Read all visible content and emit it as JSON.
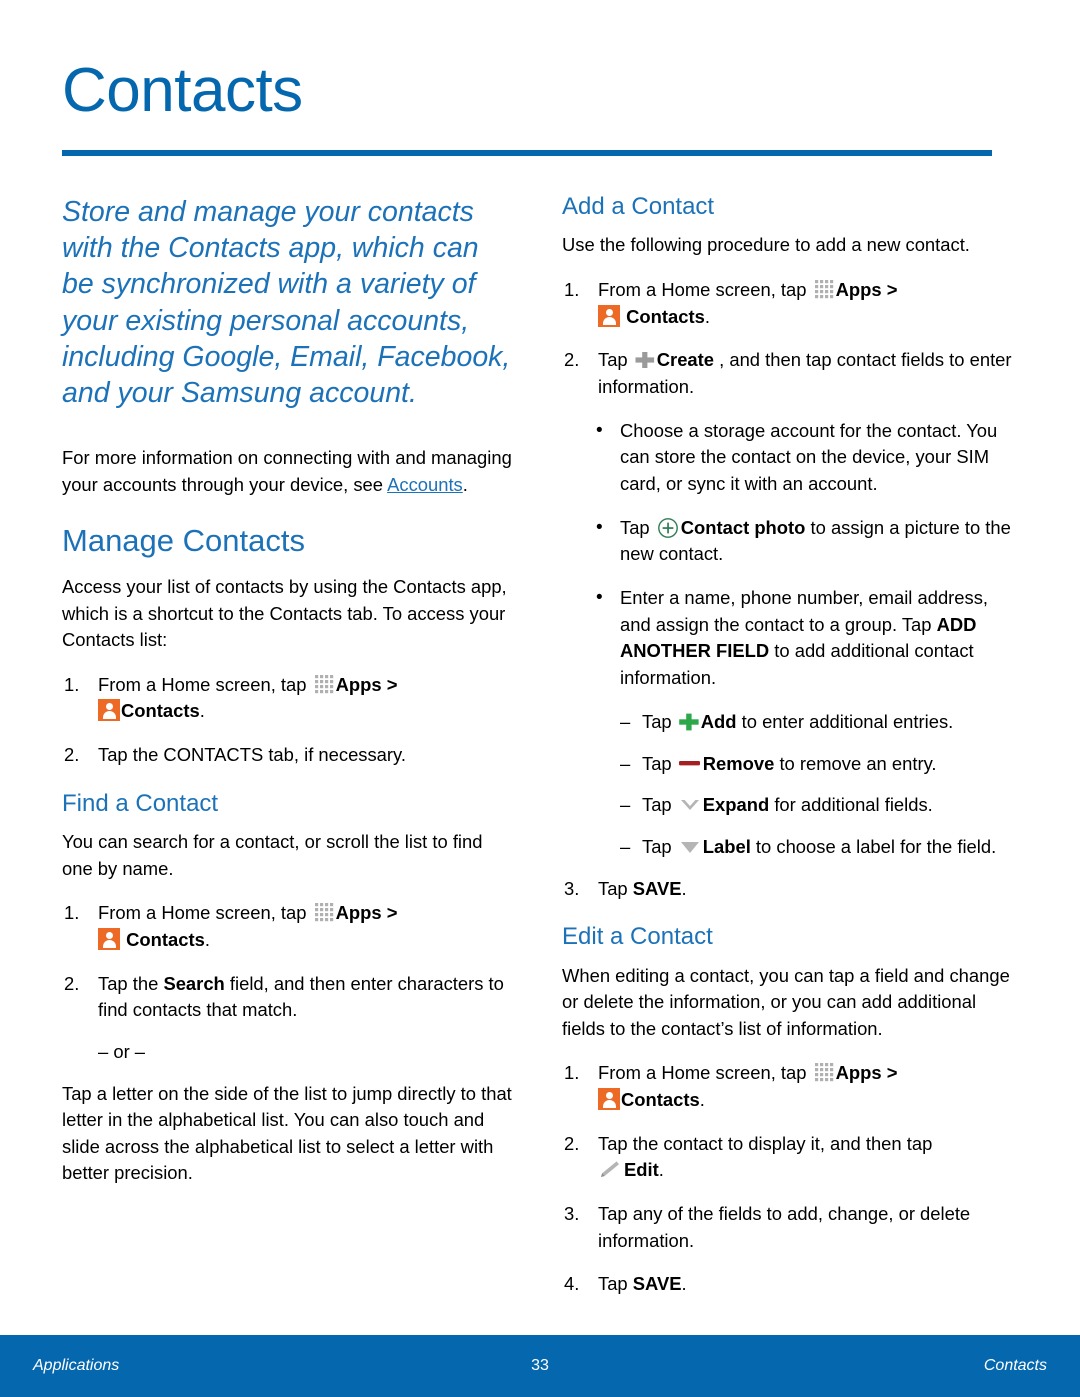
{
  "colors": {
    "brand_blue": "#0567AE",
    "heading_blue": "#1C72B8",
    "contacts_orange": "#EC6A26",
    "add_green": "#2CA84B",
    "remove_red": "#A52022",
    "icon_gray": "#9A9A9A"
  },
  "page": {
    "title": "Contacts"
  },
  "left": {
    "lede": "Store and manage your contacts with the Contacts app, which can be synchronized with a variety of your existing personal accounts, including Google, Email, Facebook, and your Samsung account.",
    "intro_before_link": "For more information on connecting with and managing your accounts through your device, see ",
    "intro_link": "Accounts",
    "intro_after_link": ".",
    "manage_heading": "Manage Contacts",
    "manage_body": "Access your list of contacts by using the Contacts app, which is a shortcut to the Contacts tab. To access your Contacts list:",
    "manage_step1": {
      "num": "1.",
      "text_a": "From a Home screen, tap ",
      "apps_label": "Apps",
      "gt": " > ",
      "contacts_label": "Contacts",
      "period": "."
    },
    "manage_step2": {
      "num": "2.",
      "text": "Tap the CONTACTS tab, if necessary."
    },
    "find_heading": "Find a Contact",
    "find_body": "You can search for a contact, or scroll the list to find one by name.",
    "find_step1": {
      "num": "1.",
      "text_a": "From a Home screen, tap ",
      "apps_label": "Apps",
      "gt": " > ",
      "contacts_label": "Contacts",
      "period": "."
    },
    "find_step2": {
      "num": "2.",
      "text_a": "Tap the ",
      "bold": "Search",
      "text_b": " field, and then enter characters to find contacts that match."
    },
    "or_line": "– or –",
    "find_alt": "Tap a letter on the side of the list to jump directly to that letter in the alphabetical list. You can also touch and slide across the alphabetical list to select a letter with better precision."
  },
  "right": {
    "add_heading": "Add a Contact",
    "add_body": "Use the following procedure to add a new contact.",
    "add_step1": {
      "num": "1.",
      "text_a": "From a Home screen, tap ",
      "apps_label": "Apps",
      "gt": " > ",
      "contacts_label": "Contacts",
      "period": "."
    },
    "add_step2": {
      "num": "2.",
      "text_a": "Tap ",
      "bold": "Create",
      "text_b": " , and then tap contact fields to enter information."
    },
    "bullets": [
      {
        "text": "Choose a storage account for the contact. You can store the contact on the device, your SIM card, or sync it with an account."
      },
      {
        "text_a": "Tap ",
        "bold": "Contact photo",
        "text_b": " to assign a picture to the new contact."
      },
      {
        "text_a": "Enter a name, phone number, email address, and assign the contact to a group. Tap ",
        "bold": "ADD ANOTHER FIELD",
        "text_b": " to add additional contact information."
      }
    ],
    "dashes": [
      {
        "text_a": "Tap ",
        "bold": "Add",
        "text_b": " to enter additional entries."
      },
      {
        "text_a": "Tap ",
        "bold": "Remove",
        "text_b": " to remove an entry."
      },
      {
        "text_a": "Tap ",
        "bold": "Expand",
        "text_b": " for additional fields."
      },
      {
        "text_a": "Tap ",
        "bold": "Label",
        "text_b": " to choose a label for the field."
      }
    ],
    "add_step3": {
      "num": "3.",
      "text_a": "Tap ",
      "bold": "SAVE",
      "text_b": "."
    },
    "edit_heading": "Edit a Contact",
    "edit_body": "When editing a contact, you can tap a field and change or delete the information, or you can add additional fields to the contact’s list of information.",
    "edit_step1": {
      "num": "1.",
      "text_a": "From a Home screen, tap ",
      "apps_label": "Apps",
      "gt": " > ",
      "contacts_label": "Contacts",
      "period": "."
    },
    "edit_step2": {
      "num": "2.",
      "text_a": "Tap the contact to display it, and then tap ",
      "bold": "Edit",
      "text_b": "."
    },
    "edit_step3": {
      "num": "3.",
      "text": "Tap any of the fields to add, change, or delete information."
    },
    "edit_step4": {
      "num": "4.",
      "text_a": "Tap ",
      "bold": "SAVE",
      "text_b": "."
    }
  },
  "footer": {
    "left": "Applications",
    "page_number": "33",
    "right": "Contacts"
  }
}
